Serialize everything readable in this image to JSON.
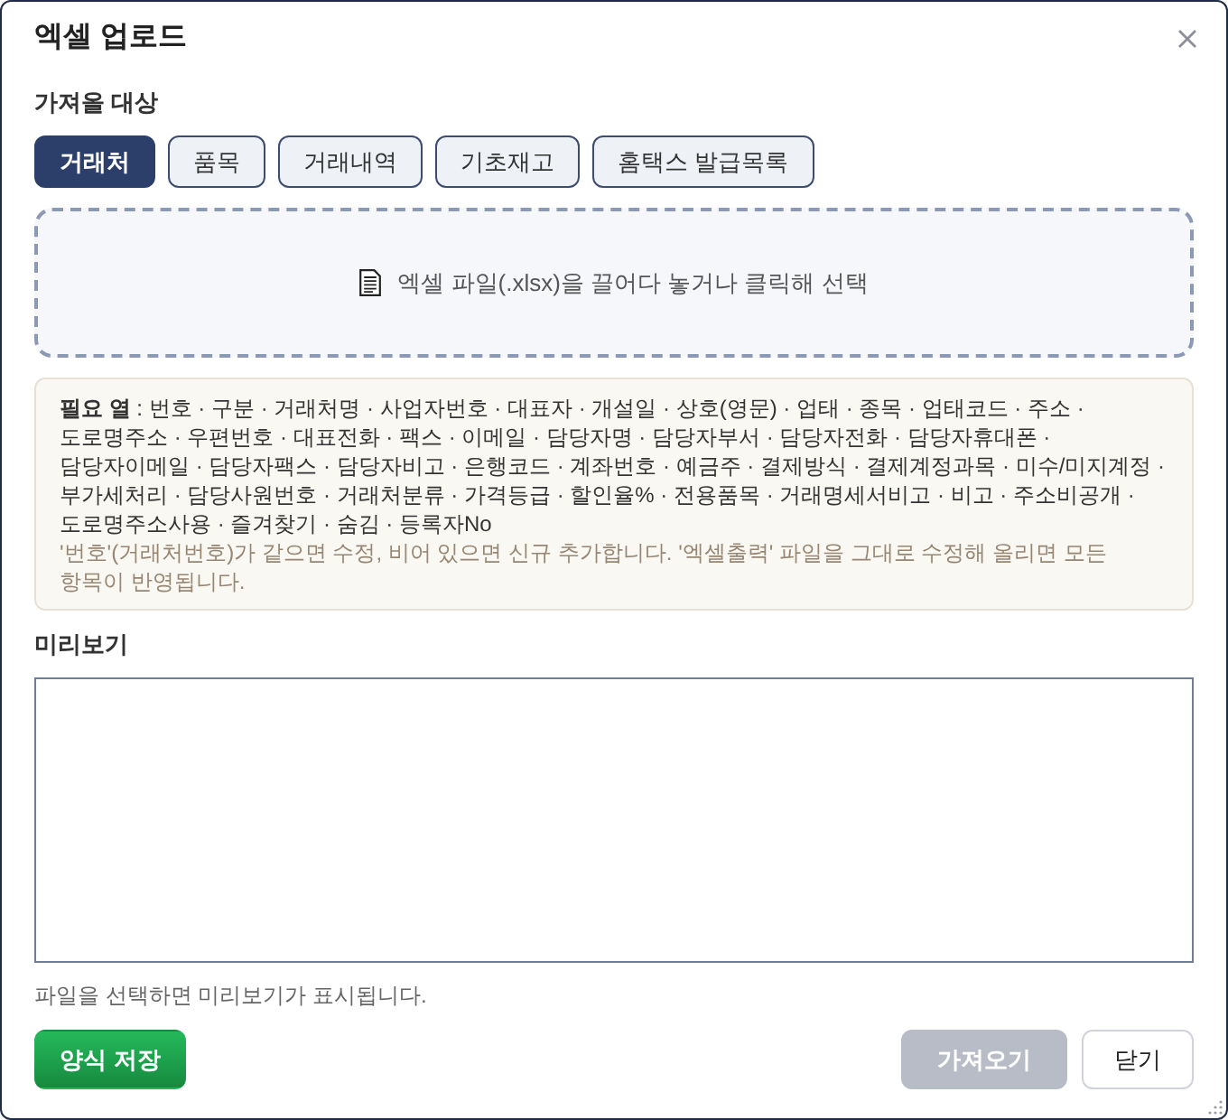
{
  "window": {
    "title": "엑셀 업로드"
  },
  "import_target": {
    "label": "가져올 대상",
    "tabs": [
      {
        "label": "거래처",
        "selected": true
      },
      {
        "label": "품목",
        "selected": false
      },
      {
        "label": "거래내역",
        "selected": false
      },
      {
        "label": "기초재고",
        "selected": false
      },
      {
        "label": "홈택스 발급목록",
        "selected": false
      }
    ]
  },
  "drop_zone": {
    "text": "엑셀 파일(.xlsx)을 끌어다 놓거나 클릭해 선택"
  },
  "info": {
    "required_columns": "**필요 열** : 번호 · 구분 · 거래처명 · 사업자번호 · 대표자 · 개설일 · 상호(영문) · 업태 · 종목 · 업태코드 · 주소 · 도로명주소 · 우편번호 · 대표전화 · 팩스 · 이메일 · 담당자명 · 담당자부서 · 담당자전화 · 담당자휴대폰 · 담당자이메일 · 담당자팩스 · 담당자비고 · 은행코드 · 계좌번호 · 예금주 · 결제방식 · 결제계정과목 · 미수/미지계정 · 부가세처리 · 담당사원번호 · 거래처분류 · 가격등급 · 할인율% · 전용품목 · 거래명세서비고 · 비고 · 주소비공개 · 도로명주소사용 · 즐겨찾기 · 숨김 · 등록자No",
    "note": "'번호'(거래처번호)가 같으면 수정, 비어 있으면 신규 추가합니다. '엑셀출력' 파일을 그대로 수정해 올리면 모든 항목이 반영됩니다."
  },
  "preview": {
    "label": "미리보기",
    "hint": "파일을 선택하면 미리보기가 표시됩니다."
  },
  "buttons": [
    {
      "kind": "save",
      "label": "양식 저장",
      "disabled": false
    },
    {
      "kind": "import",
      "label": "가져오기",
      "disabled": true
    },
    {
      "kind": "close",
      "label": "닫기",
      "disabled": false
    }
  ]
}
